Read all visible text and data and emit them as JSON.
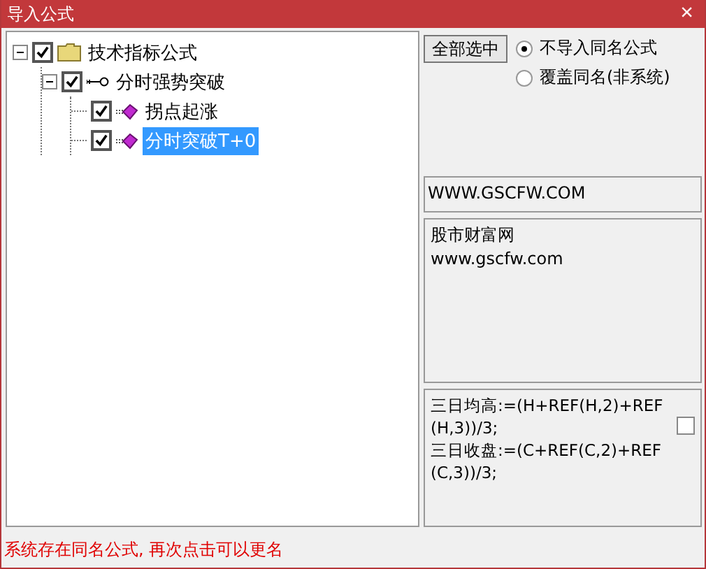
{
  "window": {
    "title": "导入公式",
    "close": "×"
  },
  "tree": [
    {
      "label": "技术指标公式",
      "kind": "folder",
      "checked": true,
      "expanded": true,
      "selected": false,
      "children": [
        {
          "label": "分时强势突破",
          "kind": "key",
          "checked": true,
          "expanded": true,
          "selected": false,
          "children": [
            {
              "label": "拐点起涨",
              "kind": "formula",
              "checked": true,
              "selected": false
            },
            {
              "label": "分时突破T+0",
              "kind": "formula",
              "checked": true,
              "selected": true
            }
          ]
        }
      ]
    }
  ],
  "select_all_button": "全部选中",
  "options": [
    {
      "label": "不导入同名公式",
      "selected": true
    },
    {
      "label": "覆盖同名(非系统)",
      "selected": false
    }
  ],
  "source_field": {
    "value": "WWW.GSCFW.COM"
  },
  "description": {
    "lines": [
      "股市财富网",
      "www.gscfw.com"
    ]
  },
  "formula": {
    "text": "三日均高:=(H+REF(H,2)+REF(H,3))/3;\n三日收盘:=(C+REF(C,2)+REF(C,3))/3;",
    "checked": false
  },
  "status": "系统存在同名公式, 再次点击可以更名"
}
